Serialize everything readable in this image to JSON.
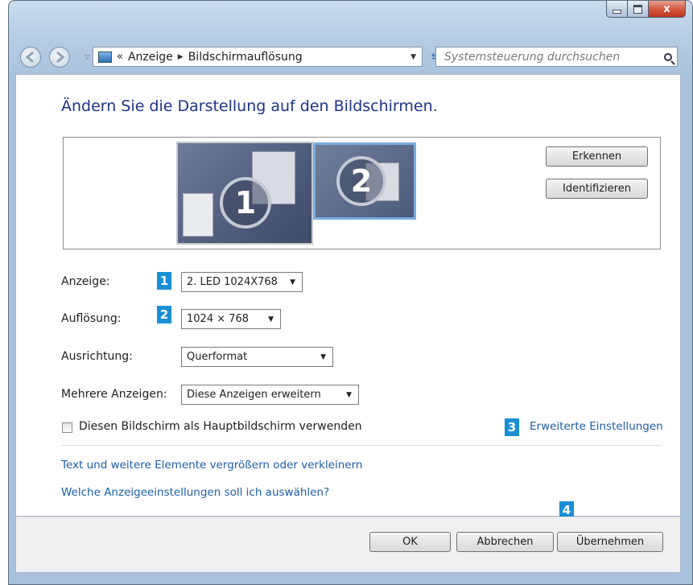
{
  "window": {
    "caption": {
      "close": "x"
    }
  },
  "nav": {
    "crumb_prefix": "«",
    "crumb1": "Anzeige",
    "crumb2": "Bildschirmauflösung",
    "search_placeholder": "Systemsteuerung durchsuchen"
  },
  "main": {
    "heading": "Ändern Sie die Darstellung auf den Bildschirmen.",
    "monitors": [
      {
        "number": "1"
      },
      {
        "number": "2"
      }
    ],
    "detect_button": "Erkennen",
    "identify_button": "Identifizieren",
    "display_label": "Anzeige:",
    "display_value": "2. LED 1024X768",
    "resolution_label": "Auflösung:",
    "resolution_value": "1024 × 768",
    "orientation_label": "Ausrichtung:",
    "orientation_value": "Querformat",
    "multi_label": "Mehrere Anzeigen:",
    "multi_value": "Diese Anzeigen erweitern",
    "primary_checkbox_label": "Diesen Bildschirm als Hauptbildschirm verwenden",
    "primary_checked": false,
    "advanced_link": "Erweiterte Einstellungen",
    "text_size_link": "Text und weitere Elemente vergrößern oder verkleinern",
    "which_settings_link": "Welche Anzeigeeinstellungen soll ich auswählen?"
  },
  "markers": [
    "1",
    "2",
    "3",
    "4"
  ],
  "footer": {
    "ok": "OK",
    "cancel": "Abbrechen",
    "apply": "Übernehmen"
  },
  "colors": {
    "heading": "#1e3287",
    "link": "#1d5ea8",
    "marker": "#1a8fd6",
    "selected_monitor_border": "#78aee0"
  }
}
